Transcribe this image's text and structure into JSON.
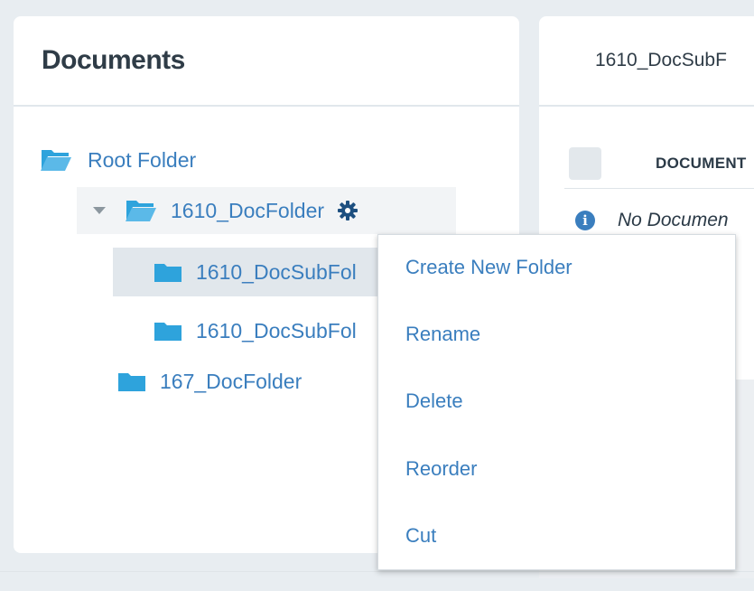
{
  "left_panel": {
    "title": "Documents"
  },
  "tree": {
    "root": {
      "label": "Root Folder",
      "icon": "folder-open-icon"
    },
    "folder_1": {
      "label": "1610_DocFolder",
      "icon": "folder-open-icon",
      "expanded": true,
      "settings_icon": "gear-icon"
    },
    "subfolder_1": {
      "label": "1610_DocSubFol",
      "icon": "folder-icon",
      "selected": true
    },
    "subfolder_2": {
      "label": "1610_DocSubFol",
      "icon": "folder-icon"
    },
    "folder_2": {
      "label": "167_DocFolder",
      "icon": "folder-icon"
    }
  },
  "right_panel": {
    "title": "1610_DocSubF",
    "column_header": "DOCUMENT",
    "empty_message": "No Documen"
  },
  "context_menu": {
    "items": [
      "Create New Folder",
      "Rename",
      "Delete",
      "Reorder",
      "Cut"
    ]
  },
  "colors": {
    "accent": "#3a7ebe",
    "folder": "#2ea3dc",
    "background": "#e8edf1"
  }
}
